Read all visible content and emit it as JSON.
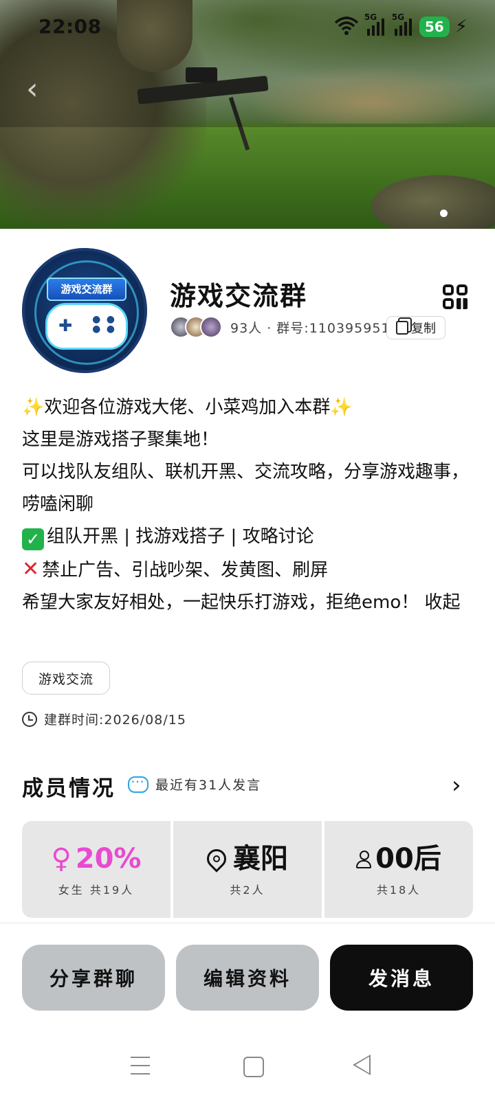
{
  "status_bar": {
    "time": "22:08",
    "signal1": "5G",
    "signal2": "5G",
    "battery": "56"
  },
  "hero": {
    "page_indicator": "1"
  },
  "group": {
    "name": "游戏交流群",
    "avatar_text": "游戏交流群",
    "member_info": "93人 · 群号:1103959517",
    "copy_label": "复制"
  },
  "description": {
    "line1": "✨欢迎各位游戏大佬、小菜鸡加入本群✨",
    "line2": "这里是游戏搭子聚集地！",
    "line3": "可以找队友组队、联机开黑、交流攻略，分享游戏趣事，唠嗑闲聊",
    "line4": "组队开黑 | 找游戏搭子 | 攻略讨论",
    "line5": "禁止广告、引战吵架、发黄图、刷屏",
    "line6": "希望大家友好相处，一起快乐打游戏，拒绝emo！",
    "collapse": "收起"
  },
  "tag": "游戏交流",
  "created": "建群时间:2026/08/15",
  "members": {
    "title": "成员情况",
    "recent": "最近有31人发言",
    "stats": [
      {
        "value": "20%",
        "sub": "女生 共19人"
      },
      {
        "value": "襄阳",
        "sub": "共2人"
      },
      {
        "value": "00后",
        "sub": "共18人"
      }
    ]
  },
  "actions": {
    "share": "分享群聊",
    "edit": "编辑资料",
    "message": "发消息"
  },
  "colors": {
    "female": "#e84ad0",
    "battery": "#22b24c",
    "primary_button": "#0e0e0e"
  }
}
